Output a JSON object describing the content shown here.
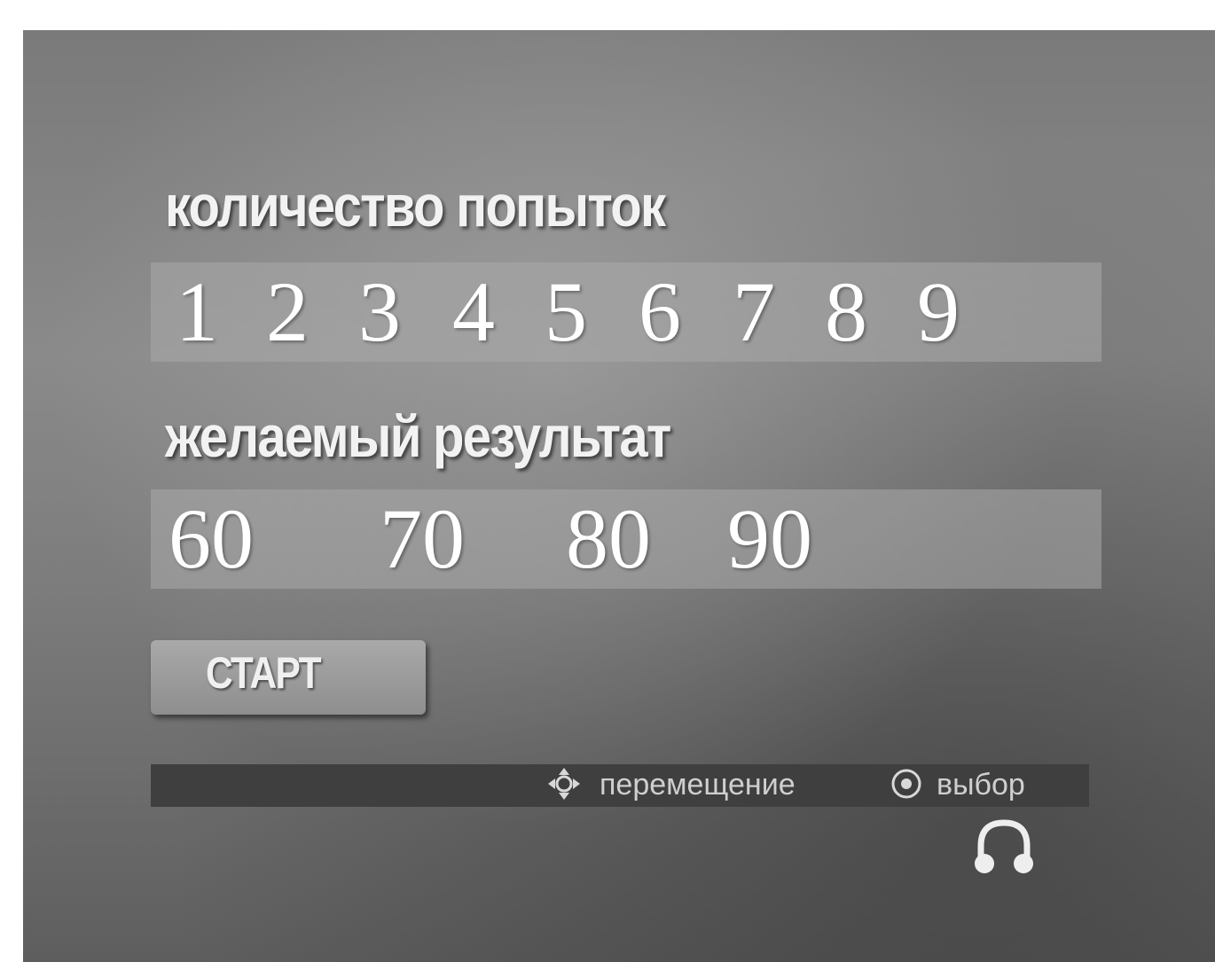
{
  "attempts": {
    "label": "количество попыток",
    "options": [
      "1",
      "2",
      "3",
      "4",
      "5",
      "6",
      "7",
      "8",
      "9"
    ]
  },
  "result": {
    "label": "желаемый результат",
    "options": [
      "60",
      "70",
      "80",
      "90"
    ]
  },
  "start_button": {
    "label": "СТАРТ"
  },
  "help": {
    "move_icon": "direction-arrows-icon",
    "move_label": "перемещение",
    "select_icon": "enter-button-icon",
    "select_label": "выбор"
  },
  "extra_icon": "headphones-icon"
}
